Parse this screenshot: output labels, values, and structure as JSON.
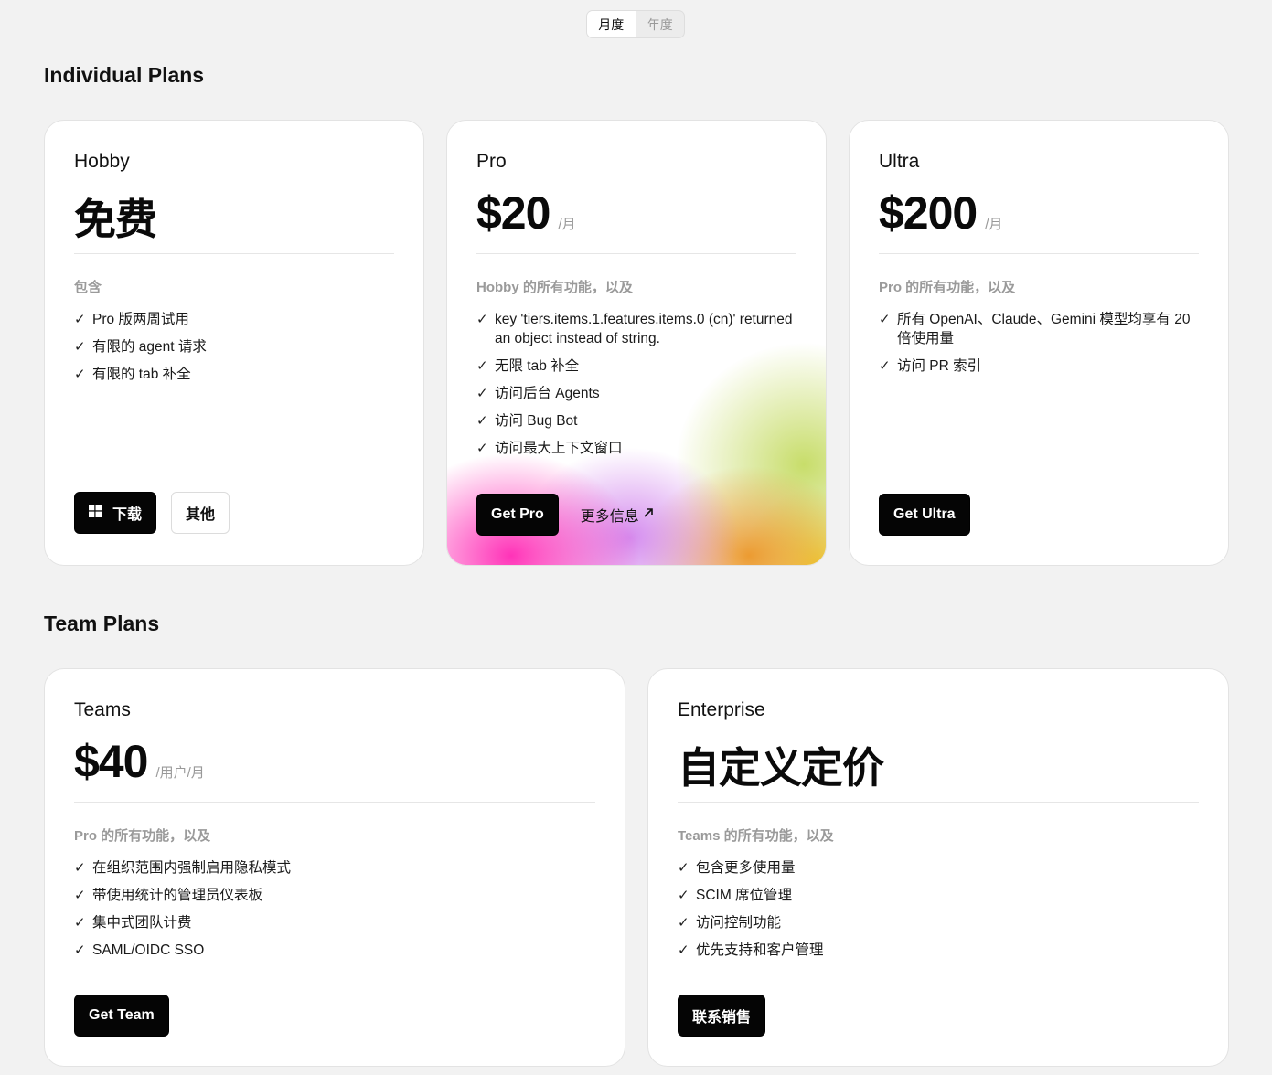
{
  "billing_toggle": {
    "monthly": "月度",
    "yearly": "年度"
  },
  "sections": {
    "individual": "Individual Plans",
    "team": "Team Plans"
  },
  "plans": {
    "hobby": {
      "name": "Hobby",
      "price": "免费",
      "features_title": "包含",
      "features": [
        "Pro 版两周试用",
        "有限的 agent 请求",
        "有限的 tab 补全"
      ],
      "download_label": "下载",
      "other_label": "其他"
    },
    "pro": {
      "name": "Pro",
      "price": "$20",
      "unit": "/月",
      "features_title": "Hobby 的所有功能，以及",
      "features": [
        "key 'tiers.items.1.features.items.0 (cn)' returned an object instead of string.",
        "无限 tab 补全",
        "访问后台 Agents",
        "访问 Bug Bot",
        "访问最大上下文窗口"
      ],
      "cta_label": "Get Pro",
      "more_label": "更多信息"
    },
    "ultra": {
      "name": "Ultra",
      "price": "$200",
      "unit": "/月",
      "features_title": "Pro 的所有功能，以及",
      "features": [
        "所有 OpenAI、Claude、Gemini 模型均享有 20 倍使用量",
        "访问 PR 索引"
      ],
      "cta_label": "Get Ultra"
    },
    "teams": {
      "name": "Teams",
      "price": "$40",
      "unit": "/用户/月",
      "features_title": "Pro 的所有功能，以及",
      "features": [
        "在组织范围内强制启用隐私模式",
        "带使用统计的管理员仪表板",
        "集中式团队计费",
        "SAML/OIDC SSO"
      ],
      "cta_label": "Get Team"
    },
    "enterprise": {
      "name": "Enterprise",
      "price": "自定义定价",
      "features_title": "Teams 的所有功能，以及",
      "features": [
        "包含更多使用量",
        "SCIM 席位管理",
        "访问控制功能",
        "优先支持和客户管理"
      ],
      "cta_label": "联系销售"
    }
  },
  "icons": {
    "check": "check-icon",
    "windows": "windows-icon",
    "arrow": "arrow-up-right-icon"
  }
}
